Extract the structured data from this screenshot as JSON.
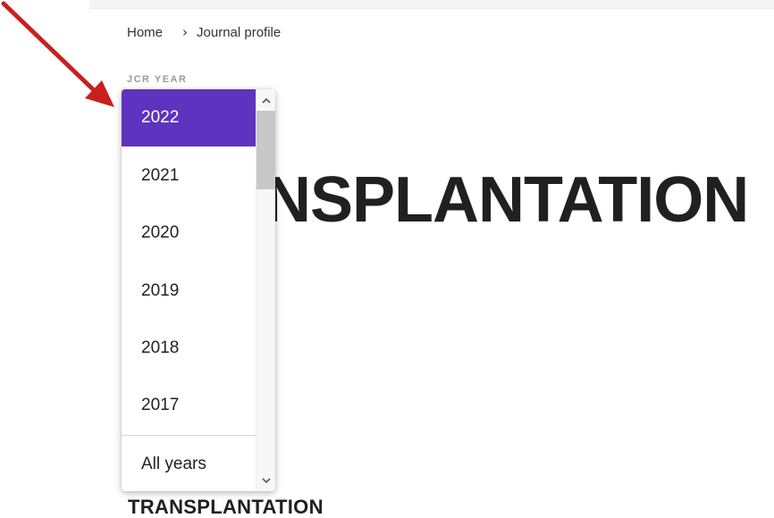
{
  "breadcrumb": {
    "home": "Home",
    "separator": "›",
    "current": "Journal profile"
  },
  "jcr_year_label": "JCR YEAR",
  "journal_title_big": "TRANSPLANTATION",
  "journal_title_big_visible": "NSPLANTATION",
  "journal_title_small": "TRANSPLANTATION",
  "dropdown": {
    "options": [
      "2022",
      "2021",
      "2020",
      "2019",
      "2018",
      "2017"
    ],
    "selected": "2022",
    "footer_option": "All years",
    "selected_color": "#5e33bf"
  },
  "annotation": {
    "arrow_color": "#c8201e",
    "arrow_icon": "red-arrow-icon"
  }
}
